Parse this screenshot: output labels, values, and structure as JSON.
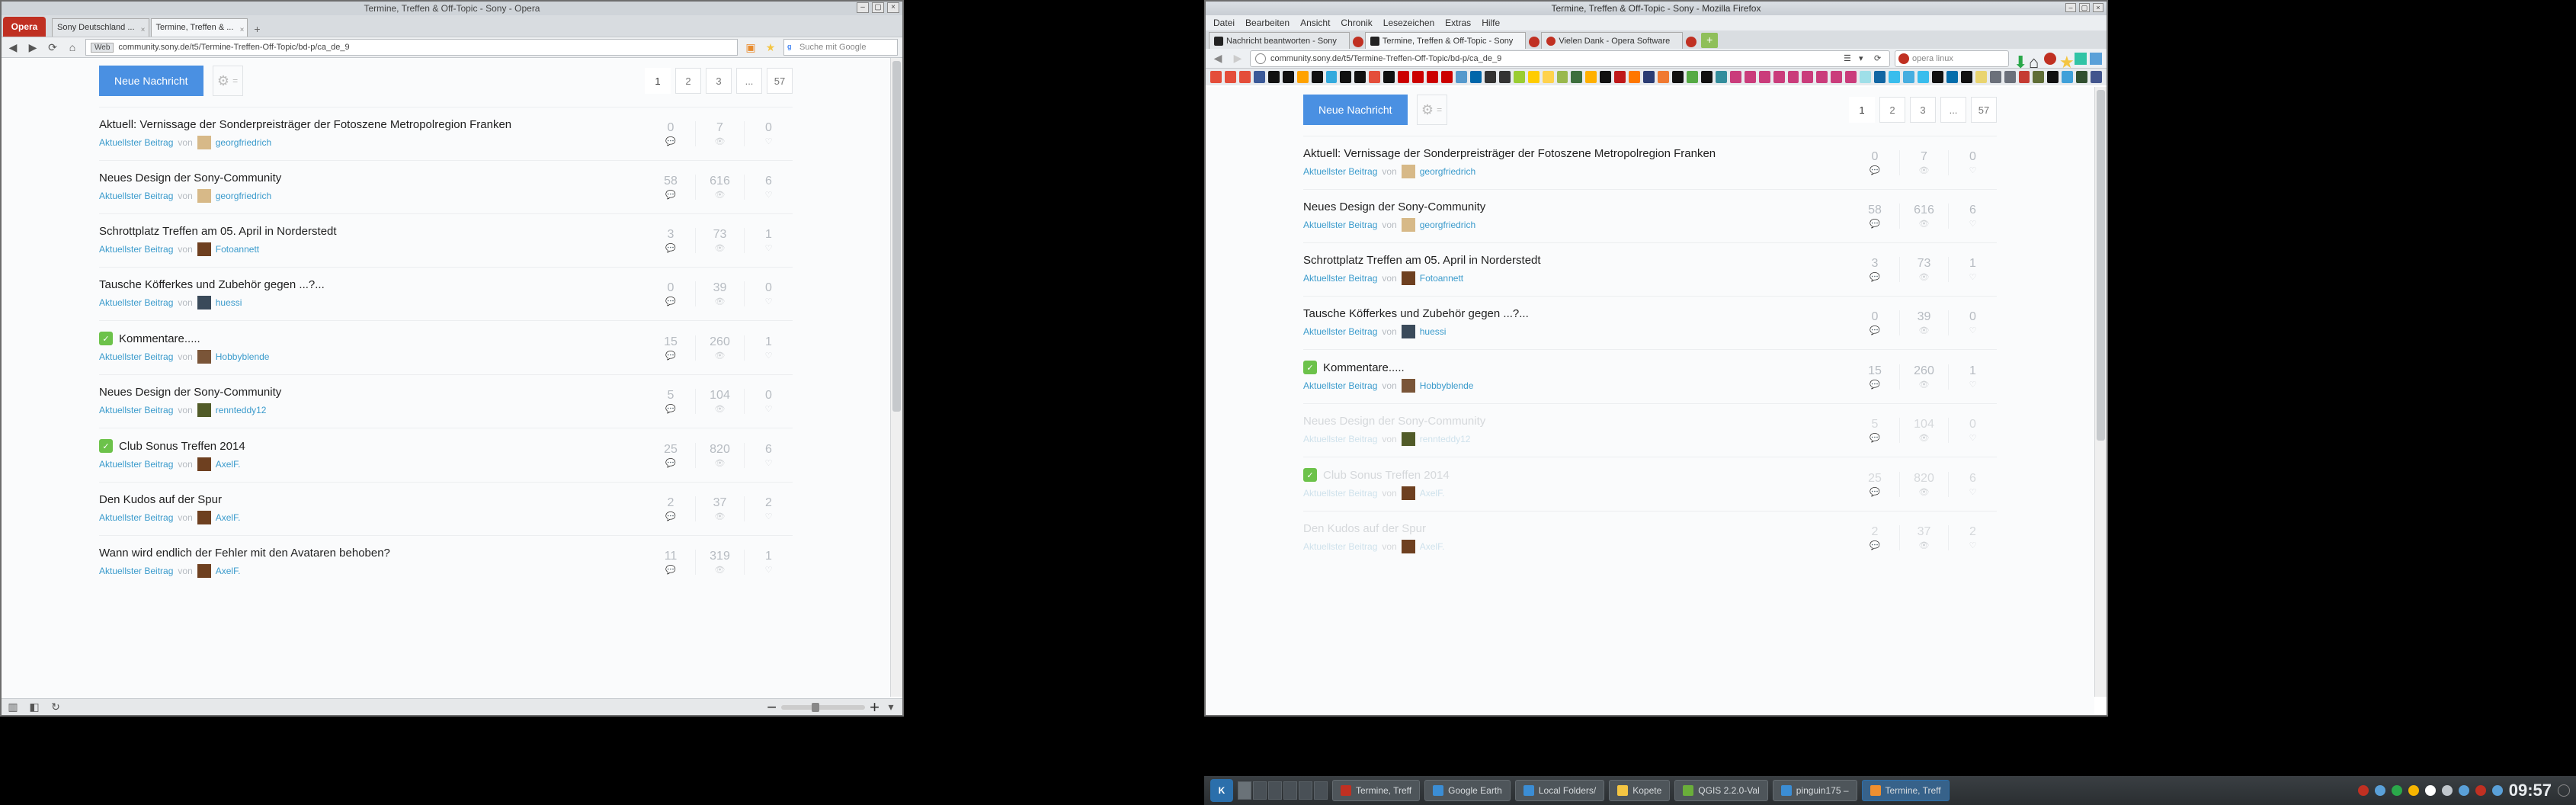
{
  "opera": {
    "window_title": "Termine, Treffen & Off-Topic - Sony - Opera",
    "menu_button": "Opera",
    "tabs": [
      "Sony Deutschland ...",
      "Termine, Treffen & ..."
    ],
    "nav": {
      "badge": "Web",
      "url": "community.sony.de/t5/Termine-Treffen-Off-Topic/bd-p/ca_de_9",
      "search_placeholder": "Suche mit Google"
    },
    "status_icons": [
      "panel-icon",
      "extensions-icon",
      "sync-icon"
    ]
  },
  "firefox": {
    "window_title": "Termine, Treffen & Off-Topic - Sony - Mozilla Firefox",
    "menus": [
      "Datei",
      "Bearbeiten",
      "Ansicht",
      "Chronik",
      "Lesezeichen",
      "Extras",
      "Hilfe"
    ],
    "tabs": [
      "Nachricht beantworten - Sony",
      "Termine, Treffen & Off-Topic - Sony",
      "Vielen Dank - Opera Software"
    ],
    "nav": {
      "url": "community.sony.de/t5/Termine-Treffen-Off-Topic/bd-p/ca_de_9",
      "search_placeholder": "opera linux"
    },
    "bookmark_colors": [
      "#e44d3a",
      "#e44d3a",
      "#e44d3a",
      "#3b5998",
      "#111",
      "#111",
      "#ffa200",
      "#111",
      "#33aadd",
      "#111",
      "#111",
      "#e44d3a",
      "#111",
      "#cc0000",
      "#cc0000",
      "#cc0000",
      "#cc0000",
      "#5599cc",
      "#0066aa",
      "#333",
      "#333",
      "#9acd32",
      "#ffcc00",
      "#ffd24d",
      "#99b84d",
      "#3d6f3d",
      "#ffb000",
      "#111",
      "#bf181a",
      "#ff7700",
      "#2b3c73",
      "#f07931",
      "#111",
      "#55aa44",
      "#111",
      "#338d9c",
      "#ca3c7b",
      "#ca3c7b",
      "#ca3c7b",
      "#ca3c7b",
      "#ca3c7b",
      "#ca3c7b",
      "#ca3c7b",
      "#ca3c7b",
      "#ca3c7b",
      "#9fdfe8",
      "#1266a3",
      "#39bded",
      "#46aee0",
      "#39bded",
      "#111",
      "#046dab",
      "#111",
      "#e9d46f",
      "#6b707a",
      "#6b707a",
      "#c53b33",
      "#5f6d36",
      "#111",
      "#3fa0d9",
      "#314f30",
      "#42558d"
    ]
  },
  "forum": {
    "new_msg": "Neue Nachricht",
    "gear_tag": "=",
    "pages": [
      "1",
      "2",
      "3",
      "...",
      "57"
    ],
    "latest": "Aktuellster Beitrag",
    "by": "von",
    "stat_icons": [
      "💬",
      "👁",
      "♡"
    ],
    "topics": [
      {
        "title": "Aktuell: Vernissage der Sonderpreisträger der Fotoszene Metropolregion Franken",
        "author": "georgfriedrich",
        "avc": "c1",
        "stats": [
          "0",
          "7",
          "0"
        ],
        "solved": false
      },
      {
        "title": "Neues Design der Sony-Community",
        "author": "georgfriedrich",
        "avc": "c1",
        "stats": [
          "58",
          "616",
          "6"
        ],
        "solved": false
      },
      {
        "title": "Schrottplatz Treffen am 05. April in Norderstedt",
        "author": "Fotoannett",
        "avc": "c2",
        "stats": [
          "3",
          "73",
          "1"
        ],
        "solved": false
      },
      {
        "title": "Tausche Köfferkes und Zubehör gegen ...?...",
        "author": "huessi",
        "avc": "c3",
        "stats": [
          "0",
          "39",
          "0"
        ],
        "solved": false
      },
      {
        "title": "Kommentare.....",
        "author": "Hobbyblende",
        "avc": "c4",
        "stats": [
          "15",
          "260",
          "1"
        ],
        "solved": true
      },
      {
        "title": "Neues Design der Sony-Community",
        "author": "rennteddy12",
        "avc": "c5",
        "stats": [
          "5",
          "104",
          "0"
        ],
        "solved": false
      },
      {
        "title": "Club Sonus Treffen 2014",
        "author": "AxelF.",
        "avc": "c2",
        "stats": [
          "25",
          "820",
          "6"
        ],
        "solved": true
      },
      {
        "title": "Den Kudos auf der Spur",
        "author": "AxelF.",
        "avc": "c2",
        "stats": [
          "2",
          "37",
          "2"
        ],
        "solved": false
      },
      {
        "title": "Wann wird endlich der Fehler mit den Avataren behoben?",
        "author": "AxelF.",
        "avc": "c2",
        "stats": [
          "11",
          "319",
          "1"
        ],
        "solved": false
      }
    ]
  },
  "kde": {
    "tasks": [
      {
        "label": "Termine, Treff",
        "color": "#c03022",
        "active": false
      },
      {
        "label": "Google Earth",
        "color": "#3b8dd4",
        "active": false
      },
      {
        "label": "Local Folders/",
        "color": "#3b8dd4",
        "active": false
      },
      {
        "label": "Kopete",
        "color": "#f4c542",
        "active": false
      },
      {
        "label": "QGIS 2.2.0-Val",
        "color": "#6aae3a",
        "active": false
      },
      {
        "label": "pinguin175 – ",
        "color": "#3b8dd4",
        "active": false
      },
      {
        "label": "Termine, Treff",
        "color": "#ef8f2f",
        "active": true
      }
    ],
    "tray_colors": [
      "#c03022",
      "#5aa0d8",
      "#2aa84a",
      "#f7b500",
      "#ffffff",
      "#c0c6cc",
      "#5aa0d8",
      "#c03022",
      "#5aa0d8"
    ],
    "clock": "09:57"
  }
}
